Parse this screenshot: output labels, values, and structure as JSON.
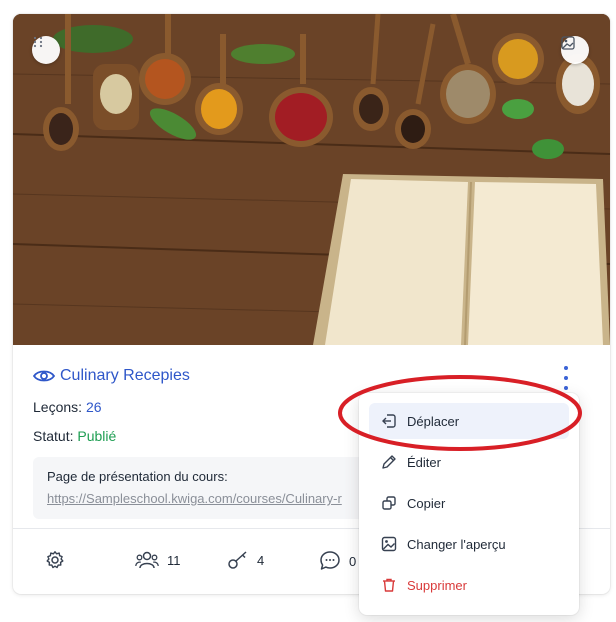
{
  "course": {
    "title": "Culinary Recepies",
    "lessons_label": "Leçons:",
    "lessons_value": "26",
    "status_label": "Statut:",
    "status_value": "Publié",
    "page_label": "Page de présentation du cours:",
    "page_url": "https://Sampleschool.kwiga.com/courses/Culinary-r"
  },
  "stats": {
    "users": "11",
    "keys": "4",
    "comments": "0"
  },
  "menu": {
    "items": [
      {
        "label": "Déplacer",
        "icon": "move-icon"
      },
      {
        "label": "Éditer",
        "icon": "pencil-icon"
      },
      {
        "label": "Copier",
        "icon": "copy-icon"
      },
      {
        "label": "Changer l'aperçu",
        "icon": "image-icon"
      },
      {
        "label": "Supprimer",
        "icon": "trash-icon"
      }
    ]
  },
  "colors": {
    "accent": "#2f57c9",
    "published": "#1e9e52",
    "danger": "#d93a3a",
    "annotation": "#d81f26"
  }
}
